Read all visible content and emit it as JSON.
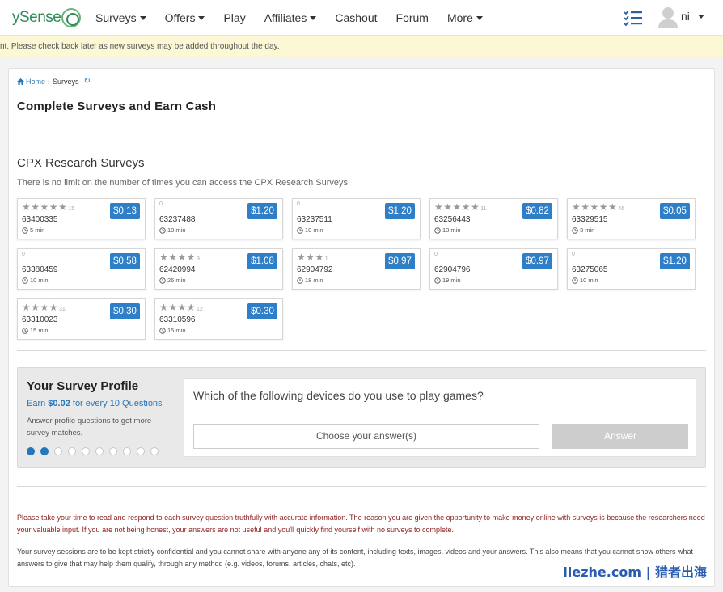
{
  "nav": {
    "logo": "ySense",
    "items": [
      {
        "label": "Surveys",
        "caret": true
      },
      {
        "label": "Offers",
        "caret": true
      },
      {
        "label": "Play",
        "caret": false
      },
      {
        "label": "Affiliates",
        "caret": true
      },
      {
        "label": "Cashout",
        "caret": false
      },
      {
        "label": "Forum",
        "caret": false
      },
      {
        "label": "More",
        "caret": true
      }
    ],
    "user": "ni"
  },
  "banner": "nt. Please check back later as new surveys may be added throughout the day.",
  "breadcrumb": {
    "home": "Home",
    "current": "Surveys"
  },
  "page_title": "Complete Surveys and Earn Cash",
  "cpx": {
    "title": "CPX Research Surveys",
    "subtitle": "There is no limit on the number of times you can access the CPX Research Surveys!"
  },
  "surveys": [
    {
      "stars": 5,
      "count": "15",
      "id": "63400335",
      "time": "5 min",
      "price": "$0.13"
    },
    {
      "stars": 0,
      "count": "0",
      "id": "63237488",
      "time": "10 min",
      "price": "$1.20"
    },
    {
      "stars": 0,
      "count": "0",
      "id": "63237511",
      "time": "10 min",
      "price": "$1.20"
    },
    {
      "stars": 5,
      "count": "11",
      "id": "63256443",
      "time": "13 min",
      "price": "$0.82"
    },
    {
      "stars": 5,
      "count": "46",
      "id": "63329515",
      "time": "3 min",
      "price": "$0.05"
    },
    {
      "stars": 0,
      "count": "0",
      "id": "63380459",
      "time": "10 min",
      "price": "$0.58"
    },
    {
      "stars": 4,
      "count": "9",
      "id": "62420994",
      "time": "26 min",
      "price": "$1.08"
    },
    {
      "stars": 3,
      "count": "1",
      "id": "62904792",
      "time": "18 min",
      "price": "$0.97"
    },
    {
      "stars": 0,
      "count": "0",
      "id": "62904796",
      "time": "19 min",
      "price": "$0.97"
    },
    {
      "stars": 0,
      "count": "0",
      "id": "63275065",
      "time": "10 min",
      "price": "$1.20"
    },
    {
      "stars": 4,
      "count": "31",
      "id": "63310023",
      "time": "15 min",
      "price": "$0.30"
    },
    {
      "stars": 4,
      "count": "12",
      "id": "63310596",
      "time": "15 min",
      "price": "$0.30"
    }
  ],
  "profile": {
    "title": "Your Survey Profile",
    "earn_prefix": "Earn ",
    "earn_amount": "$0.02",
    "earn_suffix": " for every 10 Questions",
    "description": "Answer profile questions to get more survey matches.",
    "dots_total": 10,
    "dots_filled": 2,
    "question": "Which of the following devices do you use to play games?",
    "choose_label": "Choose your answer(s)",
    "answer_label": "Answer"
  },
  "warning": "Please take your time to read and respond to each survey question truthfully with accurate information. The reason you are given the opportunity to make money online with surveys is because the researchers need your valuable input. If you are not being honest, your answers are not useful and you'll quickly find yourself with no surveys to complete.",
  "confidential": "Your survey sessions are to be kept strictly confidential and you cannot share with anyone any of its content, including texts, images, videos and your answers. This also means that you cannot show others what answers to give that may help them qualify, through any method (e.g. videos, forums, articles, chats, etc).",
  "watermark": "liezhe.com | 猎者出海",
  "colors": {
    "accent": "#2f7fc8",
    "warning": "#8b1c1c",
    "banner": "#fcf8d5"
  }
}
